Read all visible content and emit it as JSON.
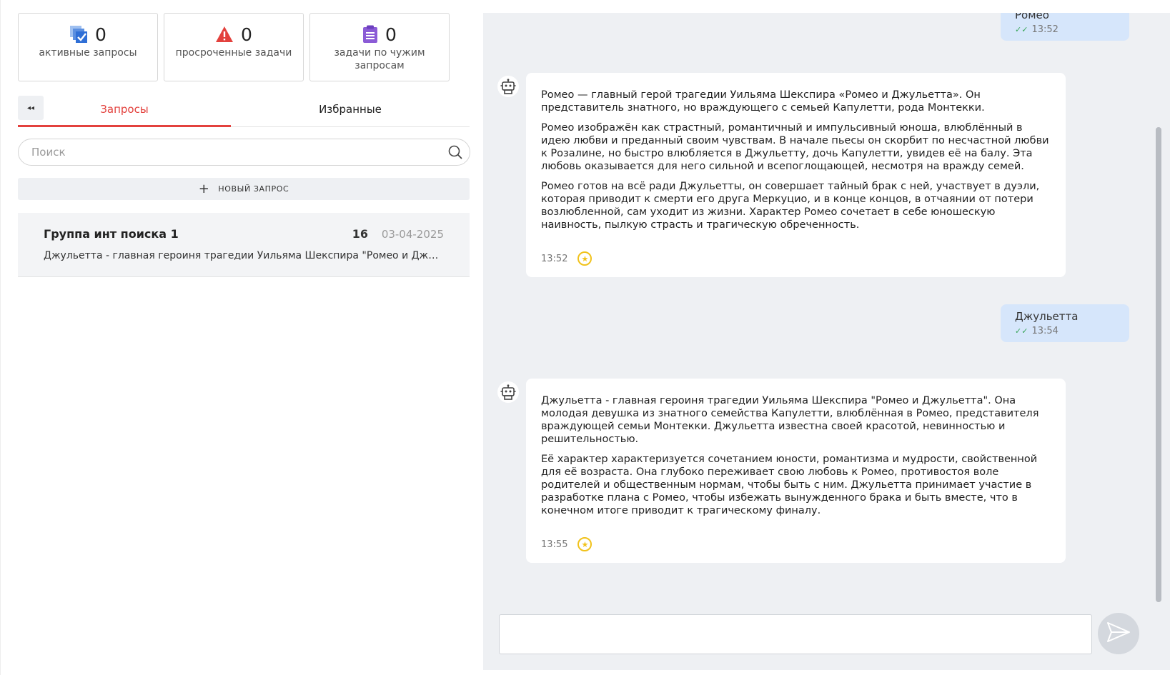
{
  "stats": [
    {
      "icon": "checklist-icon",
      "value": "0",
      "label": "активные запросы",
      "color": "#2f6fd6"
    },
    {
      "icon": "warning-icon",
      "value": "0",
      "label": "просроченные задачи",
      "color": "#e3413d"
    },
    {
      "icon": "clipboard-icon",
      "value": "0",
      "label": "задачи по чужим запросам",
      "color": "#8b5bd6"
    }
  ],
  "tabs": {
    "collapse_icon": "double-chevron-left-icon",
    "collapse_glyph": "◂◂",
    "requests": "Запросы",
    "favorites": "Избранные"
  },
  "search": {
    "placeholder": "Поиск",
    "icon": "search-icon"
  },
  "new_request": {
    "plus": "+",
    "label": "НОВЫЙ ЗАПРОС"
  },
  "requests_list": [
    {
      "title": "Группа инт поиска 1",
      "count": "16",
      "date": "03-04-2025",
      "snippet": "Джульетта - главная героиня трагедии Уильяма Шекспира \"Ромео и Джульетта\". Она молодая девушка из знатного семейства Капулетти"
    }
  ],
  "chat": {
    "messages": [
      {
        "type": "user",
        "text": "Ромео",
        "time": "13:52",
        "ticks": "✓✓"
      },
      {
        "type": "bot",
        "paragraphs": [
          "Ромео — главный герой трагедии Уильяма Шекспира «Ромео и Джульетта». Он представитель знатного, но враждующего с семьей Капулетти, рода Монтекки.",
          "Ромео изображён как страстный, романтичный и импульсивный юноша, влюблённый в идею любви и преданный своим чувствам. В начале пьесы он скорбит по несчастной любви к Розалине, но быстро влюбляется в Джульетту, дочь Капулетти, увидев её на балу. Эта любовь оказывается для него сильной и всепоглощающей, несмотря на вражду семей.",
          "Ромео готов на всё ради Джульетты, он совершает тайный брак с ней, участвует в дуэли, которая приводит к смерти его друга Меркуцио, и в конце концов, в отчаянии от потери возлюбленной, сам уходит из жизни. Характер Ромео сочетает в себе юношескую наивность, пылкую страсть и трагическую обреченность."
        ],
        "time": "13:52",
        "star": "★"
      },
      {
        "type": "user",
        "text": "Джульетта",
        "time": "13:54",
        "ticks": "✓✓"
      },
      {
        "type": "bot",
        "paragraphs": [
          "Джульетта - главная героиня трагедии Уильяма Шекспира \"Ромео и Джульетта\". Она молодая девушка из знатного семейства Капулетти, влюблённая в Ромео, представителя враждующей семьи Монтекки. Джульетта известна своей красотой, невинностью и решительностью.",
          "Её характер характеризуется сочетанием юности, романтизма и мудрости, свойственной для её возраста. Она глубоко переживает свою любовь к Ромео, противостоя воле родителей и общественным нормам, чтобы быть с ним. Джульетта принимает участие в разработке плана с Ромео, чтобы избежать вынужденного брака и быть вместе, что в конечном итоге приводит к трагическому финалу."
        ],
        "time": "13:55",
        "star": "★"
      }
    ],
    "input_placeholder": "",
    "send_icon": "send-icon"
  }
}
